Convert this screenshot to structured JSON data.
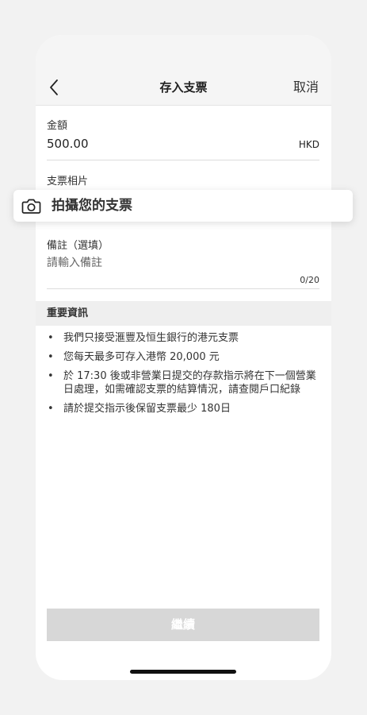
{
  "header": {
    "title": "存入支票",
    "cancel_label": "取消"
  },
  "amount": {
    "label": "金額",
    "value": "500.00",
    "currency": "HKD"
  },
  "photo": {
    "label": "支票相片",
    "action_label": "拍攝您的支票"
  },
  "remarks": {
    "label": "備註（選填）",
    "placeholder": "請輸入備註",
    "counter": "0/20"
  },
  "info": {
    "title": "重要資訊",
    "bullet": "•",
    "items": [
      "我們只接受滙豐及恒生銀行的港元支票",
      "您每天最多可存入港幣 20,000 元",
      "於 17:30 後或非營業日提交的存款指示將在下一個營業日處理，如需確認支票的結算情況，請查閱戶口紀錄",
      "請於提交指示後保留支票最少 180日"
    ]
  },
  "footer": {
    "continue_label": "繼續"
  },
  "icons": {
    "back": "chevron-left-icon",
    "camera": "camera-icon"
  },
  "colors": {
    "button_disabled": "#d7d7d7",
    "section_bg": "#efefef",
    "nav_bg": "#f5f5f5"
  }
}
